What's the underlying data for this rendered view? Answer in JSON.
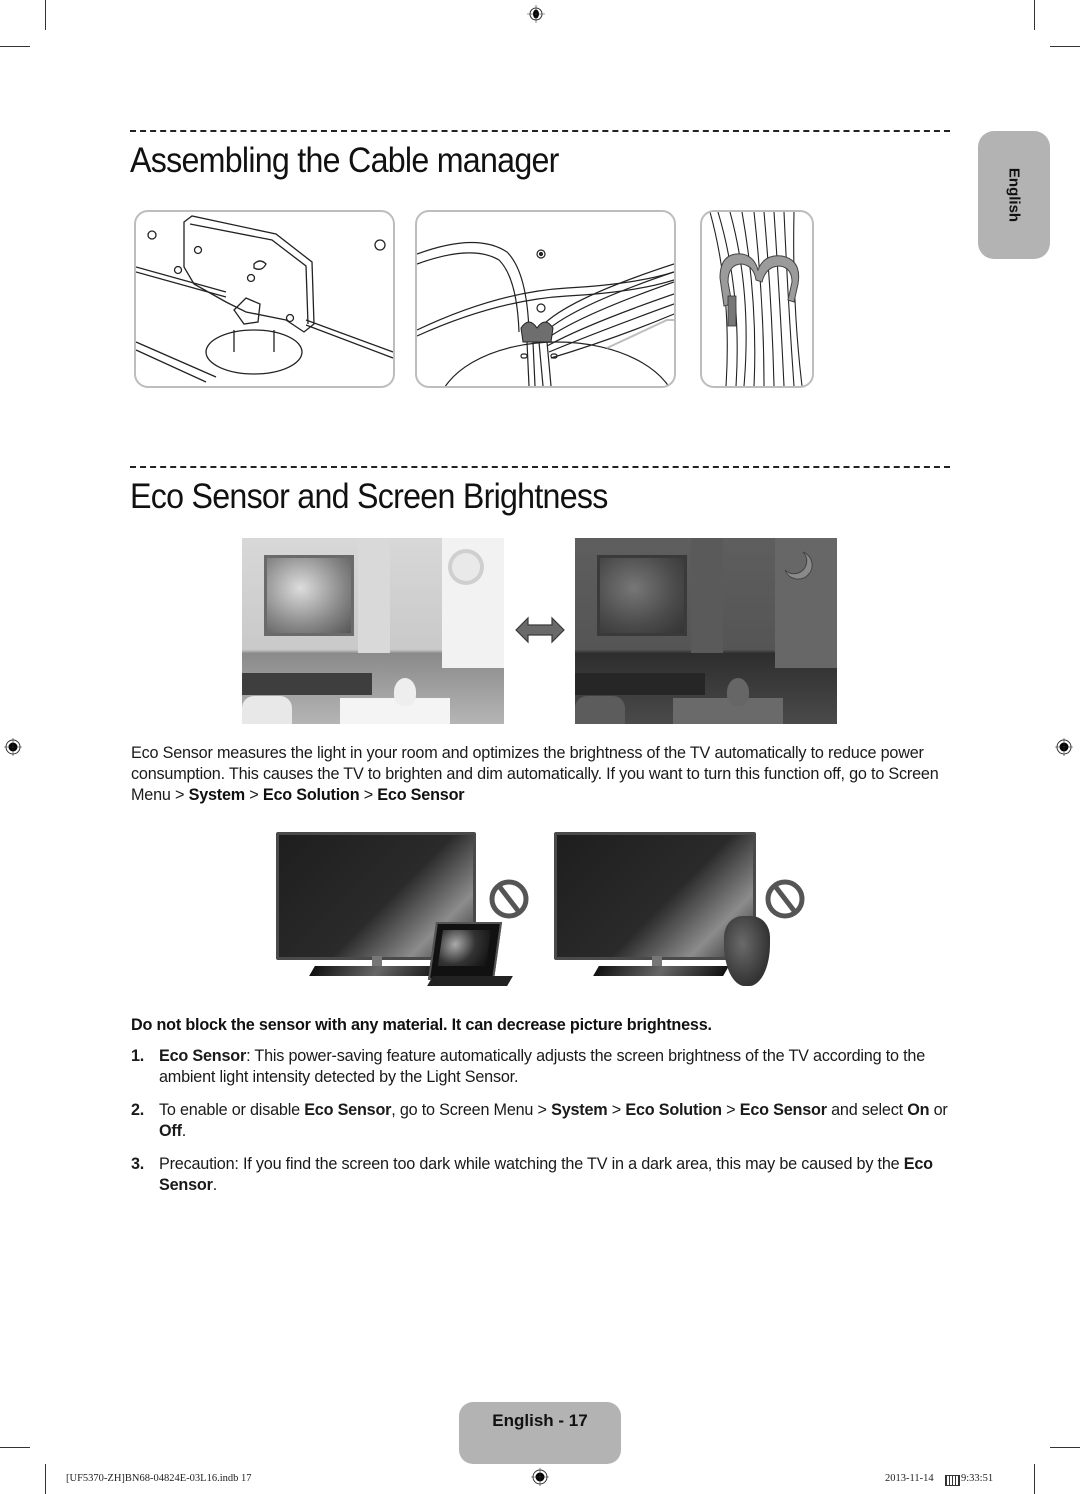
{
  "side_tab": {
    "label": "English"
  },
  "section1": {
    "title": "Assembling the Cable manager",
    "illustrations": [
      "stand-bracket-illustration",
      "cable-routing-illustration",
      "cable-holder-detail-illustration"
    ]
  },
  "section2": {
    "title": "Eco Sensor and Screen Brightness",
    "photos": [
      "bright-room-photo",
      "dark-room-photo"
    ],
    "description": {
      "text": "Eco Sensor measures the light in your room and optimizes the brightness of the TV automatically to reduce power consumption. This causes the TV to brighten and dim automatically. If you want to turn this function off, go to Screen Menu",
      "sep": ">",
      "path": [
        "System",
        "Eco Solution",
        "Eco Sensor"
      ]
    },
    "warning": "Do not block the sensor with any material. It can decrease picture brightness.",
    "list": [
      {
        "num": "1.",
        "bold_lead": "Eco Sensor",
        "text": ": This power-saving feature automatically adjusts the screen brightness of the TV according to the ambient light intensity detected by the Light Sensor."
      },
      {
        "num": "2.",
        "pre": "To enable or disable ",
        "bold1": "Eco Sensor",
        "mid": ", go to Screen Menu > ",
        "bold2": "System",
        "sep1": " > ",
        "bold3": "Eco Solution",
        "sep2": " > ",
        "bold4": "Eco Sensor",
        "mid2": " and select ",
        "bold5": "On",
        "or": " or ",
        "bold6": "Off",
        "end": "."
      },
      {
        "num": "3.",
        "pre": "Precaution: If you find the screen too dark while watching the TV in a dark area, this may be caused by the ",
        "bold": "Eco Sensor",
        "end": "."
      }
    ]
  },
  "page_tab": {
    "label": "English - 17"
  },
  "footer": {
    "file": "[UF5370-ZH]BN68-04824E-03L16.indb   17",
    "date": "2013-11-14",
    "time": "9:33:51"
  }
}
